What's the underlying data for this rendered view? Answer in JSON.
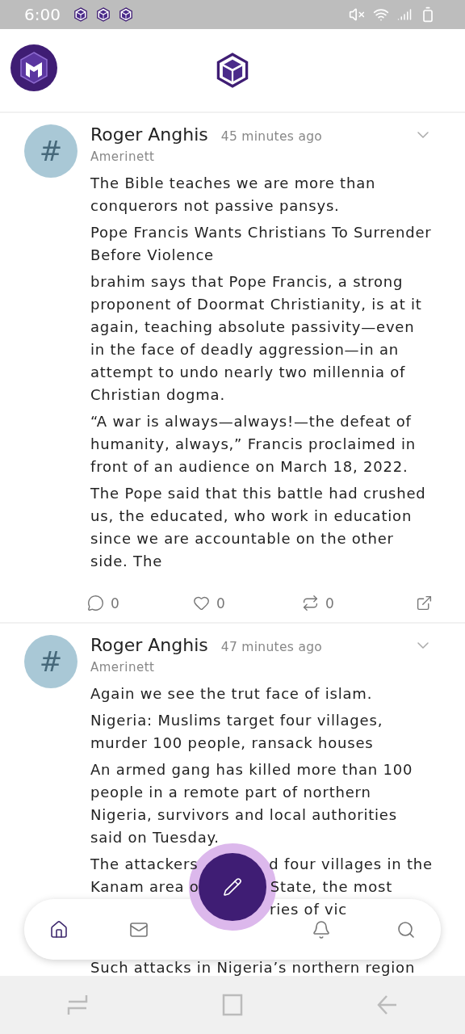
{
  "status_bar": {
    "time": "6:00"
  },
  "posts": [
    {
      "avatar_symbol": "#",
      "author": "Roger Anghis",
      "time": "45 minutes ago",
      "group": "Amerinett",
      "paragraphs": [
        {
          "kind": "text",
          "text": "The Bible teaches we are more than conquerors not passive pansys."
        },
        {
          "kind": "text",
          "text": "Pope Francis Wants Christians To Surrender Before Violence"
        },
        {
          "kind": "text",
          "text": "brahim says that Pope Francis, a strong proponent of Doormat Christianity, is at it again, teaching absolute passivity—even in the face of deadly aggression—in an attempt to undo nearly two millennia of Christian dogma."
        },
        {
          "kind": "text",
          "text": "“A war is always—always!—the defeat of humanity, always,” Francis proclaimed in front of an audience on March 18, 2022."
        },
        {
          "kind": "text",
          "text": "The Pope said that this battle had crushed us, the educated, who work in education since we are accountable on the other side. The"
        }
      ],
      "actions": [
        {
          "kind": "comment",
          "count": "0"
        },
        {
          "kind": "like",
          "count": "0"
        },
        {
          "kind": "repost",
          "count": "0"
        },
        {
          "kind": "share"
        }
      ]
    },
    {
      "avatar_symbol": "#",
      "author": "Roger Anghis",
      "time": "47 minutes ago",
      "group": "Amerinett",
      "paragraphs": [
        {
          "kind": "text",
          "text": "Again we see the trut face of islam."
        },
        {
          "kind": "text",
          "text": "Nigeria: Muslims target four villages, murder 100 people, ransack houses"
        },
        {
          "kind": "text",
          "text": " An armed gang has killed more than 100 people in a remote part of northern Nigeria, survivors and local authorities said on Tuesday."
        },
        {
          "kind": "partial",
          "lines": [
            [
              "The attackers",
              "d four villages in the"
            ],
            [
              "Kanam area o",
              "State, the most"
            ],
            [
              "ries of vic"
            ]
          ]
        },
        {
          "kind": "after_hidden",
          "text": "Such attacks in Nigeria’s northern region"
        }
      ]
    }
  ],
  "bottom_nav": [
    {
      "kind": "home",
      "selected": true
    },
    {
      "kind": "mail",
      "selected": false
    },
    {
      "kind": "notifications",
      "selected": false
    },
    {
      "kind": "search",
      "selected": false
    }
  ]
}
